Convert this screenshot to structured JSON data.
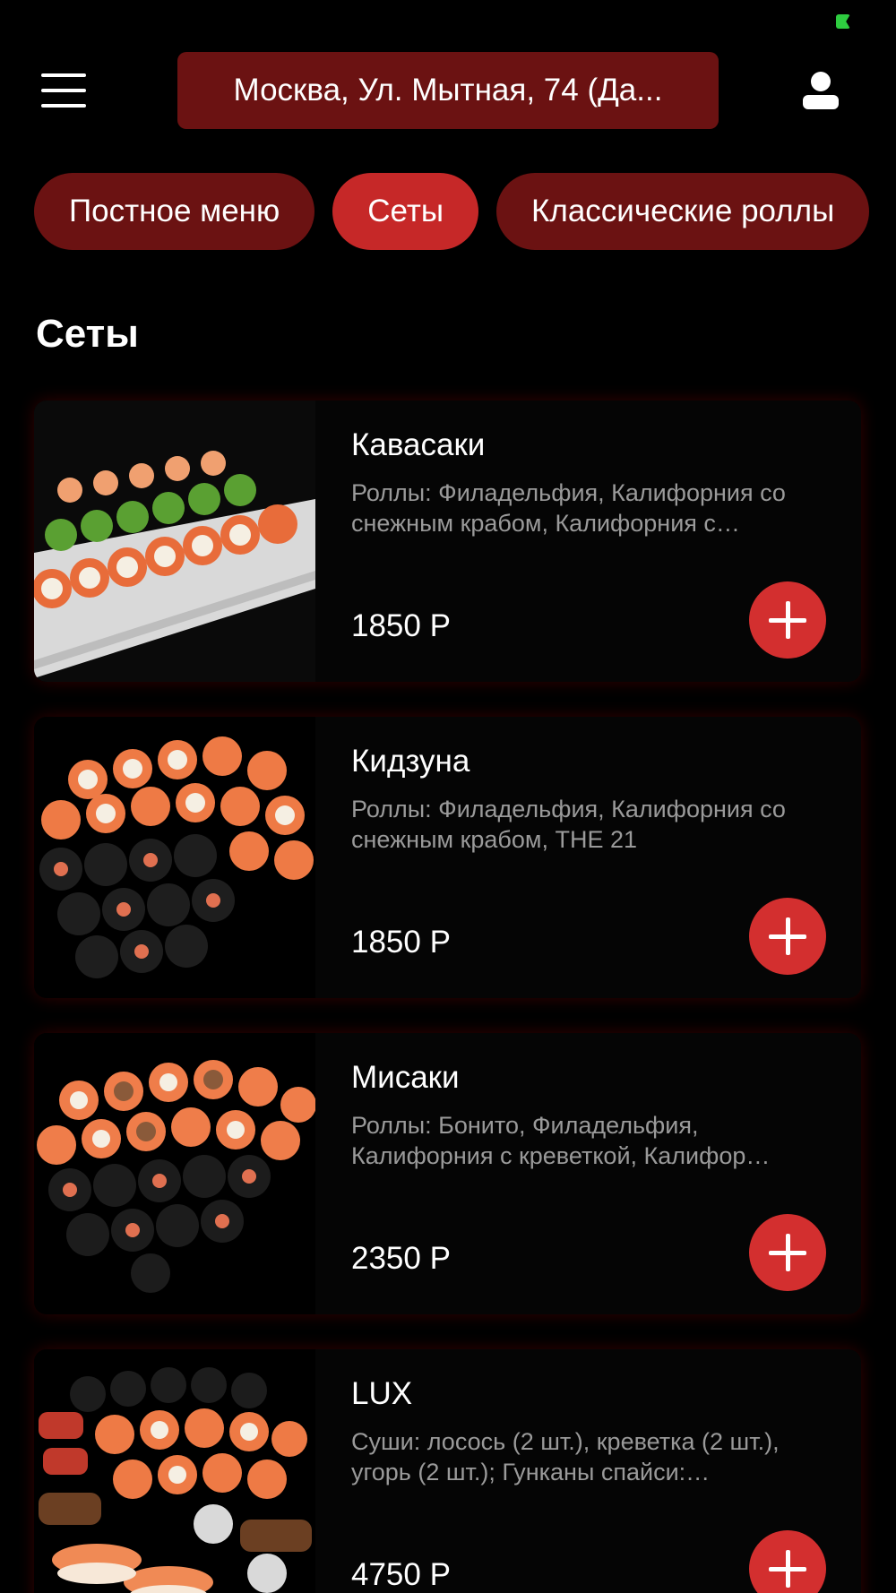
{
  "header": {
    "address": "Москва, Ул. Мытная, 74 (Да...",
    "icons": {
      "menu": "hamburger-menu-icon",
      "profile": "user-icon"
    }
  },
  "categories": [
    {
      "label": "Постное меню",
      "active": false
    },
    {
      "label": "Сеты",
      "active": true
    },
    {
      "label": "Классические роллы",
      "active": false
    }
  ],
  "section_title": "Сеты",
  "products": [
    {
      "name": "Кавасаки",
      "description": "Роллы: Филадельфия, Калифорния со снежным крабом, Калифорния с…",
      "price": "1850 Р"
    },
    {
      "name": "Кидзуна",
      "description": "Роллы: Филадельфия, Калифорния со снежным крабом, THE 21",
      "price": "1850 Р"
    },
    {
      "name": "Мисаки",
      "description": "Роллы: Бонито, Филадельфия, Калифорния с креветкой, Калифор…",
      "price": "2350 Р"
    },
    {
      "name": "LUX",
      "description": "Суши: лосось (2 шт.), креветка (2 шт.), угорь (2 шт.); Гунканы спайси:…",
      "price": "4750 Р"
    }
  ],
  "colors": {
    "background": "#000000",
    "chip": "#6b1212",
    "chip_active": "#c62828",
    "add_button": "#d32f2f",
    "muted_text": "#9a9a9a",
    "status_indicator": "#2ecc40"
  }
}
